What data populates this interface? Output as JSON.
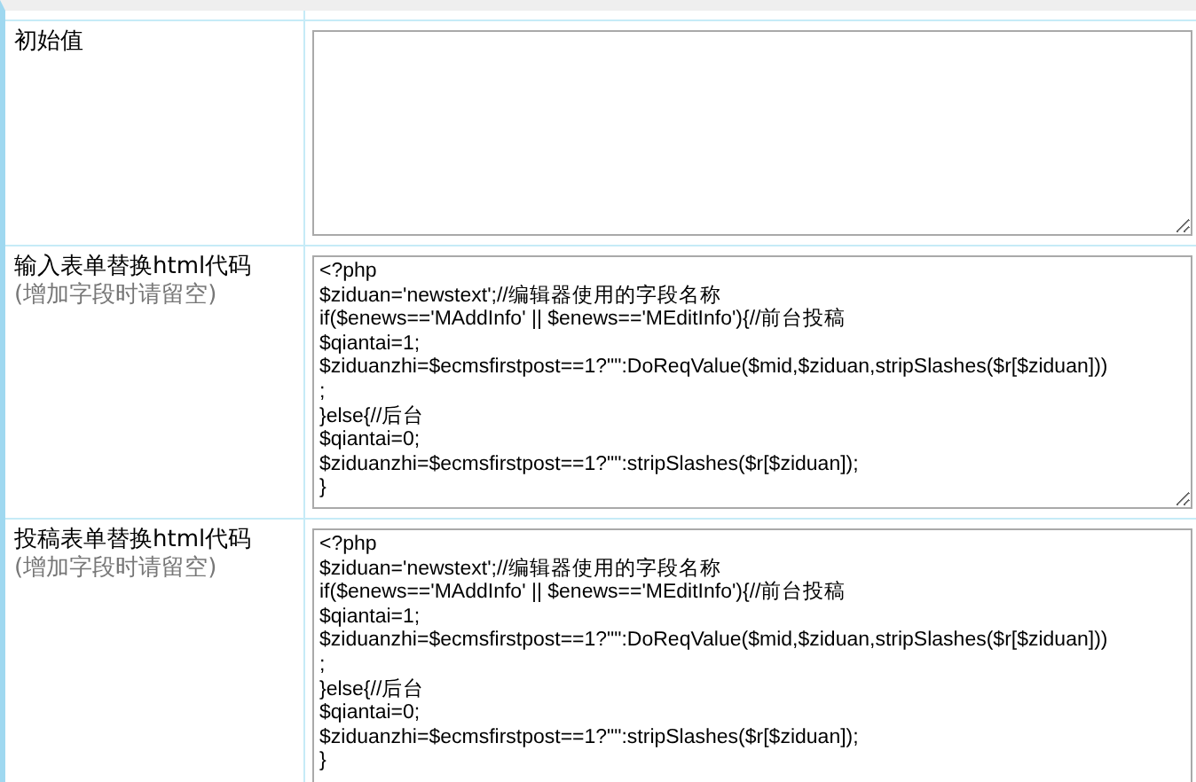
{
  "rows": [
    {
      "label": "初始值",
      "note": "",
      "value_lines": []
    },
    {
      "label": "输入表单替换html代码",
      "note": "(增加字段时请留空)",
      "value_lines": [
        "<?php",
        "$ziduan='newstext';//编辑器使用的字段名称",
        "if($enews=='MAddInfo' || $enews=='MEditInfo'){//前台投稿",
        "$qiantai=1;",
        "$ziduanzhi=$ecmsfirstpost==1?\"\":DoReqValue($mid,$ziduan,stripSlashes($r[$ziduan]))",
        ";",
        "}else{//后台",
        "$qiantai=0;",
        "$ziduanzhi=$ecmsfirstpost==1?\"\":stripSlashes($r[$ziduan]);",
        "}"
      ]
    },
    {
      "label": "投稿表单替换html代码",
      "note": "(增加字段时请留空)",
      "value_lines": [
        "<?php",
        "$ziduan='newstext';//编辑器使用的字段名称",
        "if($enews=='MAddInfo' || $enews=='MEditInfo'){//前台投稿",
        "$qiantai=1;",
        "$ziduanzhi=$ecmsfirstpost==1?\"\":DoReqValue($mid,$ziduan,stripSlashes($r[$ziduan]))",
        ";",
        "}else{//后台",
        "$qiantai=0;",
        "$ziduanzhi=$ecmsfirstpost==1?\"\":stripSlashes($r[$ziduan]);",
        "}"
      ]
    }
  ]
}
